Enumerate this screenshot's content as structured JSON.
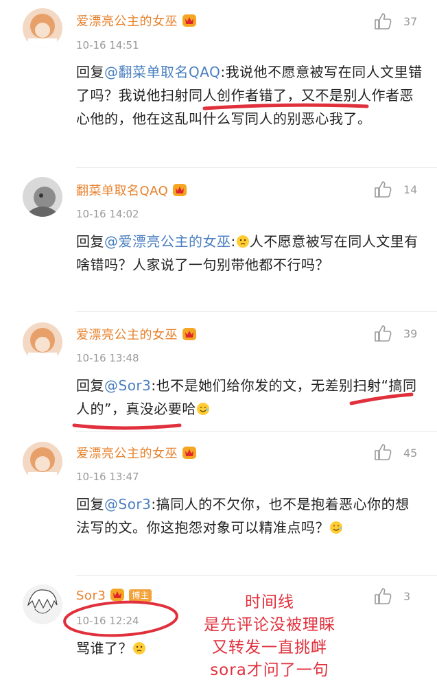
{
  "comments": [
    {
      "name": "爱漂亮公主的女巫",
      "time": "10-16 14:51",
      "likes": "37",
      "reply_prefix": "回复",
      "mention": "@翻菜单取名QAQ",
      "text": ":我说他不愿意被写在同人文里错了吗？我说他扫射同人创作者错了，又不是别人作者恶心他的，他在这乱叫什么写同人的别恶心我了。"
    },
    {
      "name": "翻菜单取名QAQ",
      "time": "10-16 14:02",
      "likes": "14",
      "reply_prefix": "回复",
      "mention": "@爱漂亮公主的女巫",
      "text": "人不愿意被写在同人文里有啥错吗？人家说了一句别带他都不行吗？"
    },
    {
      "name": "爱漂亮公主的女巫",
      "time": "10-16 13:48",
      "likes": "39",
      "reply_prefix": "回复",
      "mention": "@Sor3",
      "text": ":也不是她们给你发的文，无差别扫射“搞同人的”，真没必要哈"
    },
    {
      "name": "爱漂亮公主的女巫",
      "time": "10-16 13:47",
      "likes": "45",
      "reply_prefix": "回复",
      "mention": "@Sor3",
      "text": ":搞同人的不欠你，也不是抱着恶心你的想法写的文。你这抱怨对象可以精准点吗？"
    },
    {
      "name": "Sor3",
      "badge": "博主",
      "time": "10-16 12:24",
      "likes": "3",
      "text": "骂谁了？"
    }
  ],
  "annotation": {
    "lines": [
      "时间线",
      "是先评论没被理睬",
      "又转发一直挑衅",
      "sora才问了一句"
    ],
    "color": "#e0303c"
  },
  "icons": {
    "like": "thumbs-up-icon",
    "vip": "vip-crown-icon"
  }
}
